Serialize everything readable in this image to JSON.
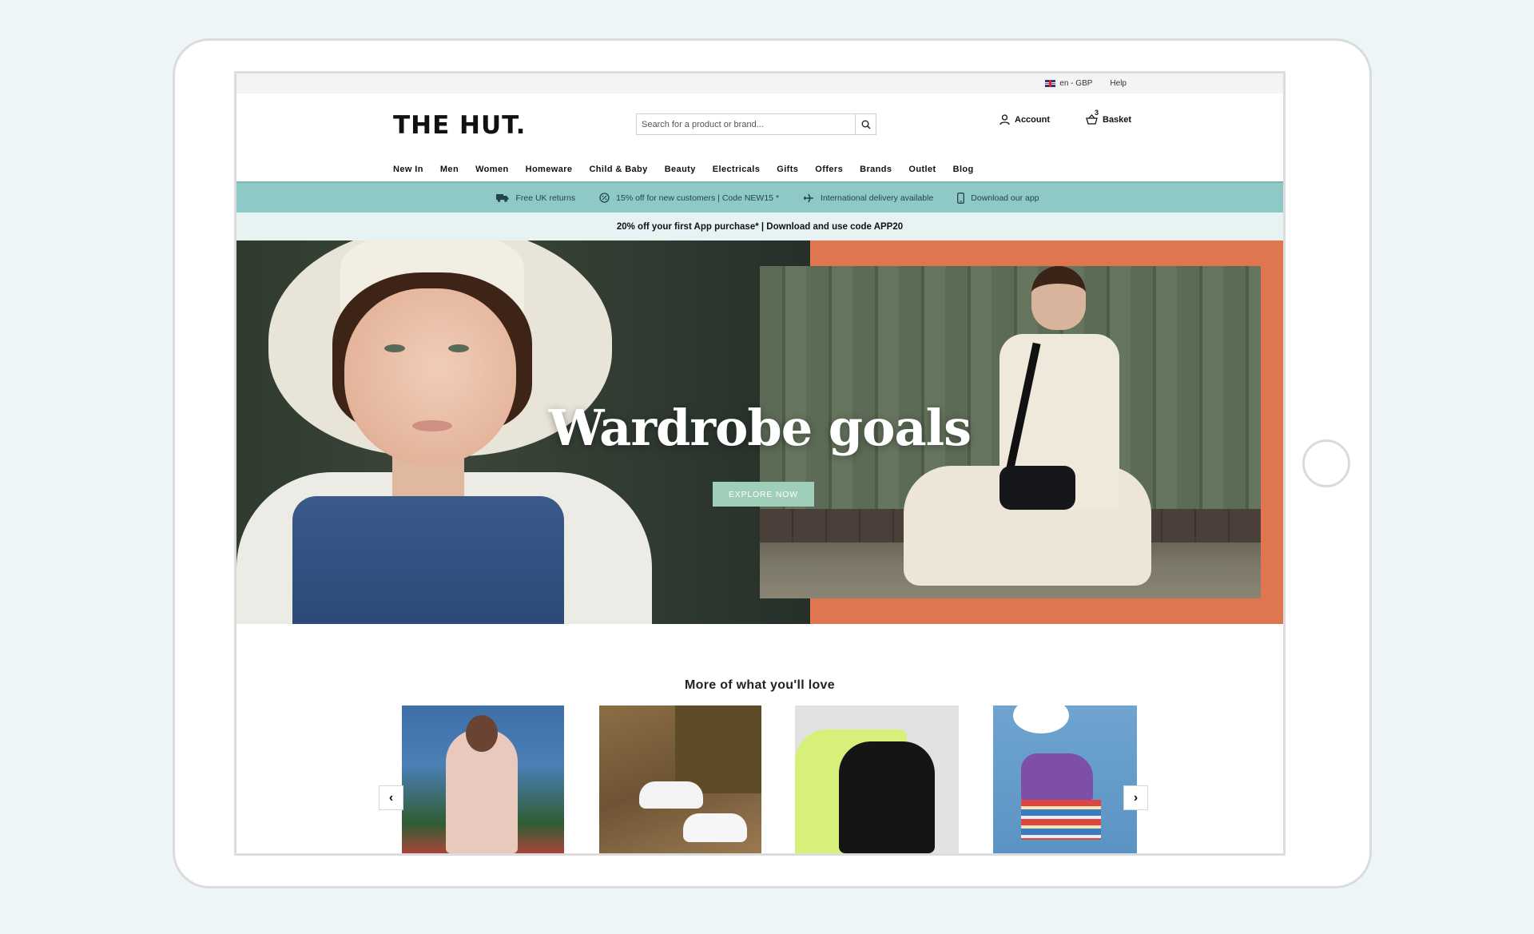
{
  "utility": {
    "locale": "en - GBP",
    "help": "Help"
  },
  "header": {
    "logo": "THE HUT.",
    "search_placeholder": "Search for a product or brand...",
    "account_label": "Account",
    "basket_label": "Basket",
    "basket_count": "3"
  },
  "nav": {
    "items": [
      "New In",
      "Men",
      "Women",
      "Homeware",
      "Child & Baby",
      "Beauty",
      "Electricals",
      "Gifts",
      "Offers",
      "Brands",
      "Outlet",
      "Blog"
    ]
  },
  "usp": {
    "items": [
      {
        "icon": "truck-icon",
        "label": "Free UK returns"
      },
      {
        "icon": "discount-badge-icon",
        "label": "15% off for new customers | Code NEW15 *"
      },
      {
        "icon": "plane-icon",
        "label": "International delivery available"
      },
      {
        "icon": "phone-icon",
        "label": "Download our app"
      }
    ]
  },
  "promo": {
    "text": "20% off your first App purchase* | Download and use code APP20"
  },
  "hero": {
    "title": "Wardrobe goals",
    "cta": "EXPLORE NOW"
  },
  "carousel": {
    "title": "More of what you'll love",
    "prev": "‹",
    "next": "›"
  },
  "colors": {
    "usp_bg": "#8ec9c8",
    "promo_bg": "#e7f3f3",
    "hero_accent": "#e07650",
    "cta_bg": "#9fcfb8"
  }
}
